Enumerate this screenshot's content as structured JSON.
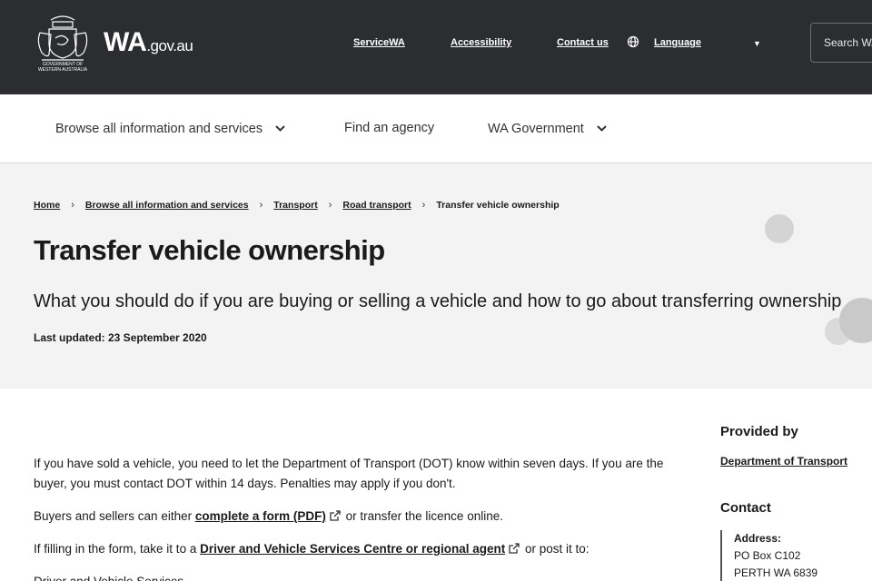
{
  "header": {
    "logo_caption_line1": "GOVERNMENT OF",
    "logo_caption_line2": "WESTERN AUSTRALIA",
    "site_name": "WA",
    "site_domain": ".gov.au",
    "links": {
      "servicewa": "ServiceWA",
      "accessibility": "Accessibility",
      "contact": "Contact us",
      "language": "Language"
    },
    "search_placeholder": "Search WA"
  },
  "nav": {
    "browse": "Browse all information and services",
    "agency": "Find an agency",
    "government": "WA Government"
  },
  "breadcrumb": {
    "home": "Home",
    "browse": "Browse all information and services",
    "transport": "Transport",
    "road": "Road transport",
    "current": "Transfer vehicle ownership"
  },
  "hero": {
    "title": "Transfer vehicle ownership",
    "subtitle": "What you should do if you are buying or selling a vehicle and how to go about transferring ownership",
    "last_updated": "Last updated: 23 September 2020"
  },
  "content": {
    "p1": "If you have sold a vehicle, you need to let the Department of Transport (DOT) know within seven days. If you are the buyer, you must contact DOT within 14 days. Penalties may apply if you don't.",
    "p2_before": "Buyers and sellers can either ",
    "p2_link": "complete a form (PDF)",
    "p2_after": " or transfer the licence online.",
    "p3_before": "If filling in the form, take it to a ",
    "p3_link": "Driver and Vehicle Services Centre or regional agent",
    "p3_after": " or post it to:",
    "p4": "Driver and Vehicle Services"
  },
  "sidebar": {
    "provided_by_heading": "Provided by",
    "provider_link": "Department of Transport",
    "contact_heading": "Contact",
    "address_label": "Address:",
    "address_line1": "PO Box C102",
    "address_line2": "PERTH WA 6839"
  }
}
